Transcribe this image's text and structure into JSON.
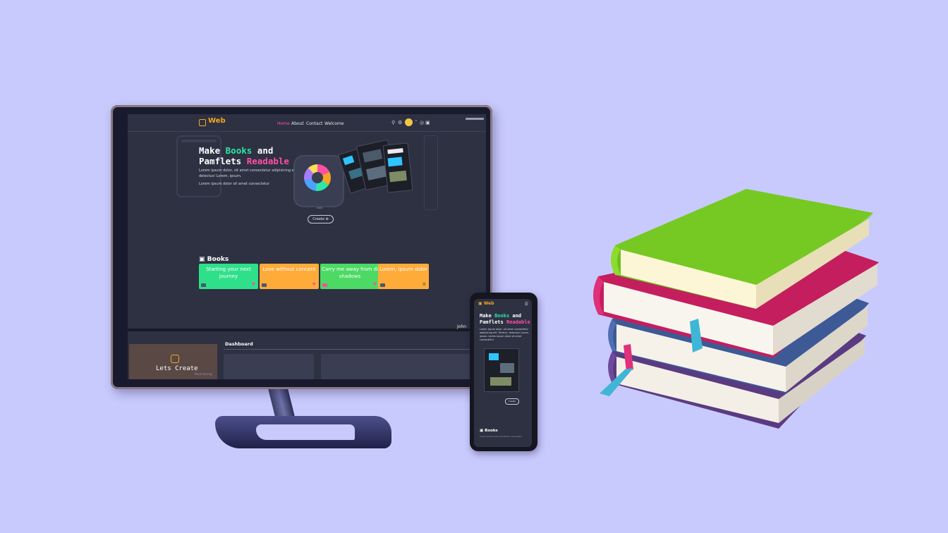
{
  "web": {
    "logo": "Web",
    "nav": [
      "Home",
      "About",
      "Contact",
      "Welcome"
    ],
    "hero": {
      "title_part1": "Make ",
      "title_green": "Books",
      "title_part2": " and",
      "title_line2": "Pamflets ",
      "title_pink": "Readable",
      "description": "Lorem ipsum dolor, sit amet consectetur adipisicing elit. Tenetur, delectus! Lorem, ipsum.",
      "description2": "Lorem ipsum dolor sit amet consectetur",
      "create_label": "Create"
    },
    "books": {
      "heading": "Books",
      "cards": [
        {
          "title": "Starting your next journey",
          "color": "#2fe08a"
        },
        {
          "title": "Love without concent",
          "color": "#ffab3a"
        },
        {
          "title": "Carry me away from di shadows",
          "color": "#4cd964"
        },
        {
          "title": "Lorem, ipsum dolor",
          "color": "#ffab3a"
        }
      ]
    },
    "dashboard": {
      "user": "John",
      "title": "Dashboard",
      "sidebar_title": "Lets Create",
      "sidebar_sub": "Book boxing"
    }
  },
  "phone": {
    "logo": "Web",
    "hero_part1": "Make ",
    "hero_green": "Books",
    "hero_part2": " and",
    "hero_line2": "Pamflets ",
    "hero_pink": "Readable",
    "description": "Lorem ipsum dolor, sit amet consectetur adipisicing elit. Tenetur, delectus! Lorem, ipsum. Lorem ipsum dolor sit amet consectetur",
    "create_label": "Create",
    "books_heading": "Books",
    "books_sub": "Lorem ipsum dolor sit amet consectetur"
  }
}
